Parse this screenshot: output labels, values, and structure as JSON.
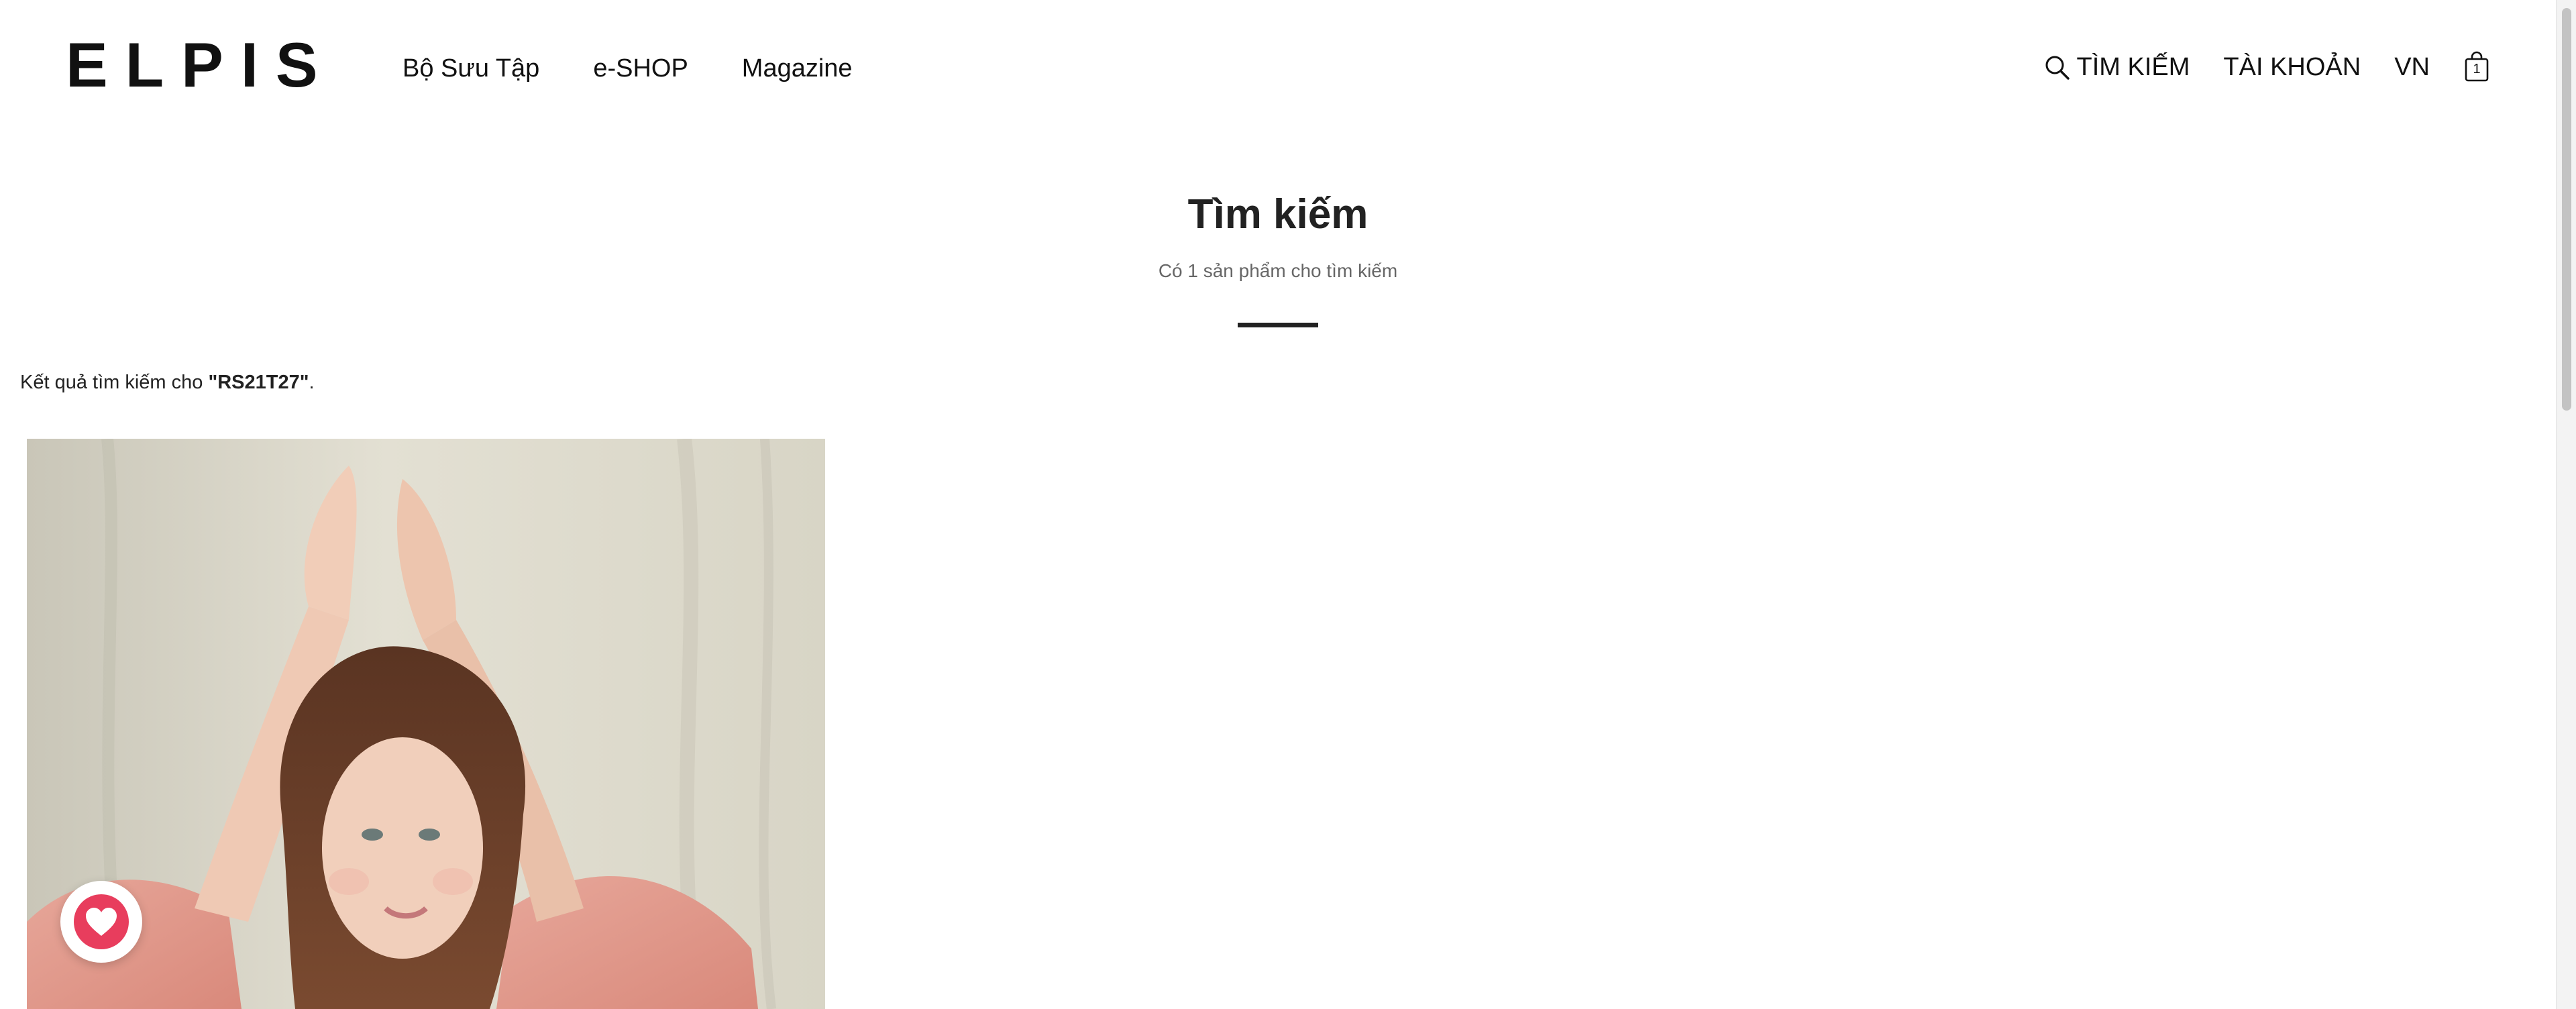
{
  "header": {
    "logo": "ELPIS",
    "nav": [
      "Bộ Sưu Tập",
      "e-SHOP",
      "Magazine"
    ],
    "search_label": "TÌM KIẾM",
    "account_label": "TÀI KHOẢN",
    "language": "VN",
    "cart_count": "1"
  },
  "search": {
    "title": "Tìm kiếm",
    "subtitle": "Có 1 sản phẩm cho tìm kiếm",
    "results_prefix": "Kết quả tìm kiếm cho ",
    "query_display": "\"RS21T27\"",
    "results_suffix": "."
  },
  "colors": {
    "accent": "#e83d5d",
    "text": "#222222",
    "muted": "#666666"
  },
  "icons": {
    "search": "search-icon",
    "cart": "shopping-bag-icon",
    "wishlist": "heart-icon"
  }
}
